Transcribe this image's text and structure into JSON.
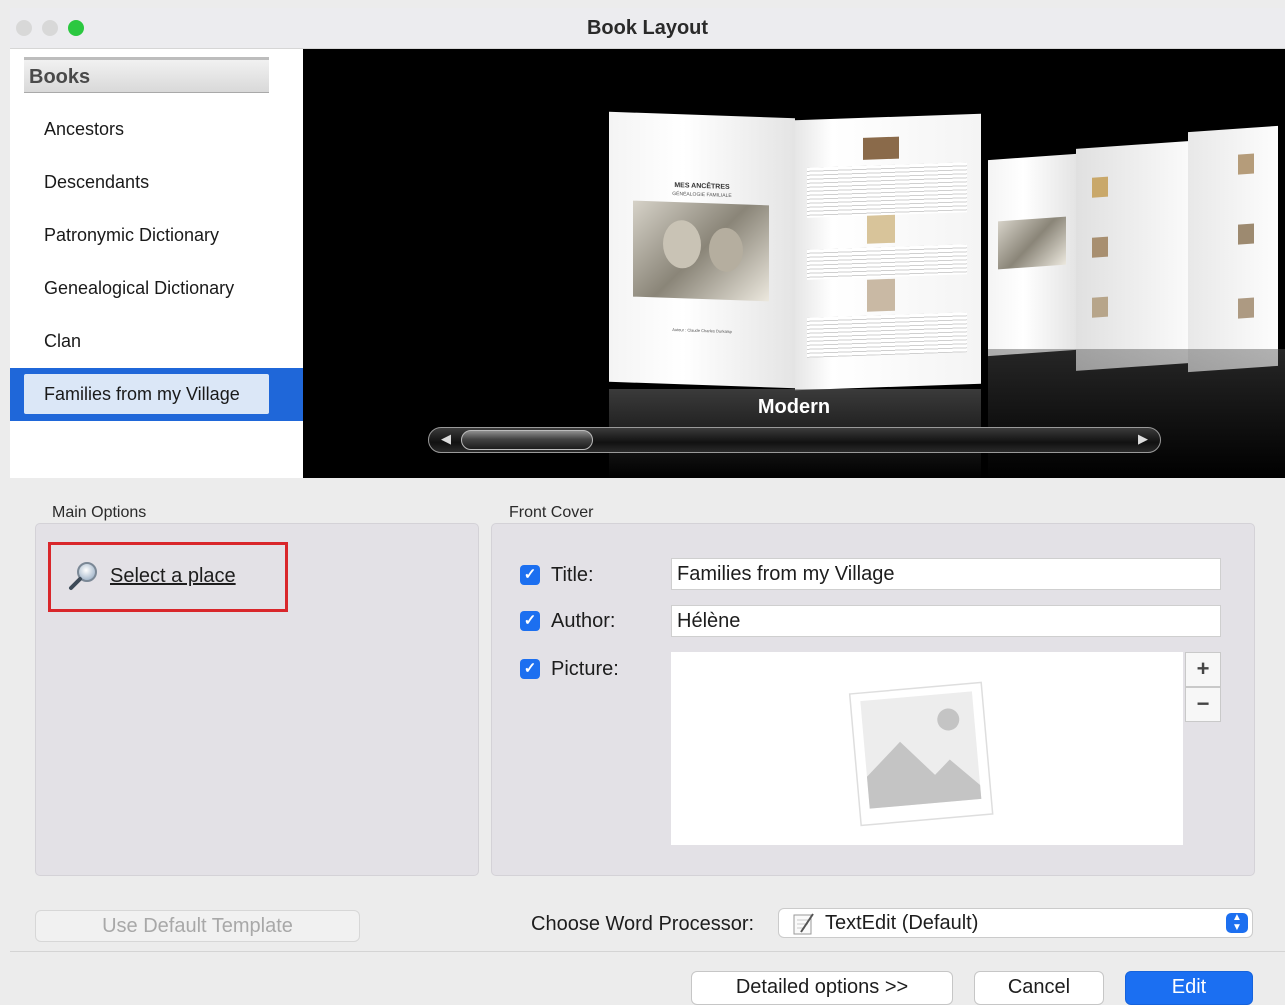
{
  "window": {
    "title": "Book Layout",
    "traffic_lights": {
      "close": "#d8d8d8",
      "minimize": "#d8d8d8",
      "zoom": "#2bc840"
    }
  },
  "sidebar": {
    "header": "Books",
    "items": [
      {
        "label": "Ancestors"
      },
      {
        "label": "Descendants"
      },
      {
        "label": "Patronymic Dictionary"
      },
      {
        "label": "Genealogical Dictionary"
      },
      {
        "label": "Clan"
      },
      {
        "label": "Families from my Village",
        "selected": true
      }
    ]
  },
  "preview": {
    "template_name": "Modern",
    "book_title": "MES ANCÊTRES",
    "book_subtitle": "GÉNÉALOGIE FAMILIALE",
    "book_author": "Auteur : Claude Charles Durkalsp"
  },
  "main_options": {
    "label": "Main Options",
    "select_place": "Select a place",
    "select_place_icon": "magnifier-icon"
  },
  "front_cover": {
    "label": "Front Cover",
    "title": {
      "label": "Title:",
      "checked": true,
      "value": "Families from my Village"
    },
    "author": {
      "label": "Author:",
      "checked": true,
      "value": "Hélène"
    },
    "picture": {
      "label": "Picture:",
      "checked": true,
      "add": "+",
      "remove": "−",
      "placeholder_icon": "image-placeholder-icon"
    }
  },
  "use_default_template": "Use Default Template",
  "word_processor": {
    "label": "Choose Word Processor:",
    "selected": "TextEdit (Default)",
    "icon": "textedit-icon"
  },
  "footer": {
    "detailed_options": "Detailed options >>",
    "cancel": "Cancel",
    "edit": "Edit"
  },
  "colors": {
    "accent": "#1c6ff0",
    "highlight_border": "#d9262b"
  }
}
